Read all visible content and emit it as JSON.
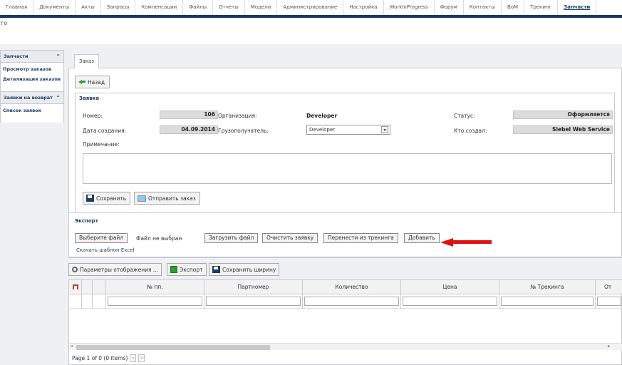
{
  "nav": {
    "items": [
      "Главная",
      "Документы",
      "Акты",
      "Запросы",
      "Компенсации",
      "Файлы",
      "Отчеты",
      "Модели",
      "Администрирование",
      "Настройка",
      "WorkInProgress",
      "Форум",
      "Контакты",
      "BoM",
      "Трекинг",
      "Запчасти"
    ],
    "active_index": 15
  },
  "subtitle": "го",
  "sidebar": {
    "section1_title": "Запчасти",
    "section1_items": [
      "Просмотр заказов",
      "Детализация заказов"
    ],
    "section2_title": "Заявки на возврат",
    "section2_items": [
      "Список заявок"
    ]
  },
  "tab": {
    "label": "Заказ"
  },
  "order": {
    "back_label": "Назад",
    "legend": "Заявка",
    "number_label": "Номер:",
    "number_value": "106",
    "created_label": "Дата создания:",
    "created_value": "04.09.2014",
    "org_label": "Организация:",
    "org_value": "Developer",
    "consignee_label": "Грузополучатель:",
    "consignee_value": "Developer",
    "status_label": "Статус:",
    "status_value": "Оформляется",
    "creator_label": "Кто создал:",
    "creator_value": "Siebel Web Service",
    "note_label": "Примечание:",
    "save_label": "Сохранить",
    "send_label": "Отправить заказ"
  },
  "export": {
    "title": "Экспорт",
    "choose_file": "Выберите файл",
    "no_file": "Файл не выбран",
    "upload": "Загрузить файл",
    "clear": "Очистить заявку",
    "from_tracking": "Перенести из трекинга",
    "add": "Добавить",
    "template_link": "Скачать шаблон Excel"
  },
  "toolbar": {
    "view_params": "Параметры отображения ...",
    "export": "Экспорт",
    "save_width": "Сохранить ширину"
  },
  "grid": {
    "columns": [
      "№ пп.",
      "Партномер",
      "Количество",
      "Цена",
      "№ Трекинга",
      "От"
    ],
    "pager": "Page 1 of 0 (0 items)"
  }
}
